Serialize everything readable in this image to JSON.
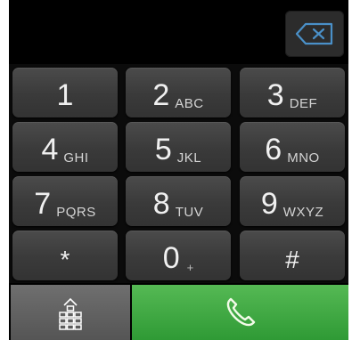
{
  "keypad": {
    "keys": [
      {
        "digit": "1",
        "letters": ""
      },
      {
        "digit": "2",
        "letters": "ABC"
      },
      {
        "digit": "3",
        "letters": "DEF"
      },
      {
        "digit": "4",
        "letters": "GHI"
      },
      {
        "digit": "5",
        "letters": "JKL"
      },
      {
        "digit": "6",
        "letters": "MNO"
      },
      {
        "digit": "7",
        "letters": "PQRS"
      },
      {
        "digit": "8",
        "letters": "TUV"
      },
      {
        "digit": "9",
        "letters": "WXYZ"
      },
      {
        "digit": "*",
        "letters": ""
      },
      {
        "digit": "0",
        "letters": "+"
      },
      {
        "digit": "#",
        "letters": ""
      }
    ]
  },
  "display": {
    "number": ""
  },
  "icons": {
    "backspace": "backspace-icon",
    "dialpad": "dialpad-icon",
    "call": "phone-icon"
  },
  "colors": {
    "call_green": "#3aa83c",
    "icon_blue": "#4a90c8",
    "key_gray": "#3e3e3e"
  }
}
